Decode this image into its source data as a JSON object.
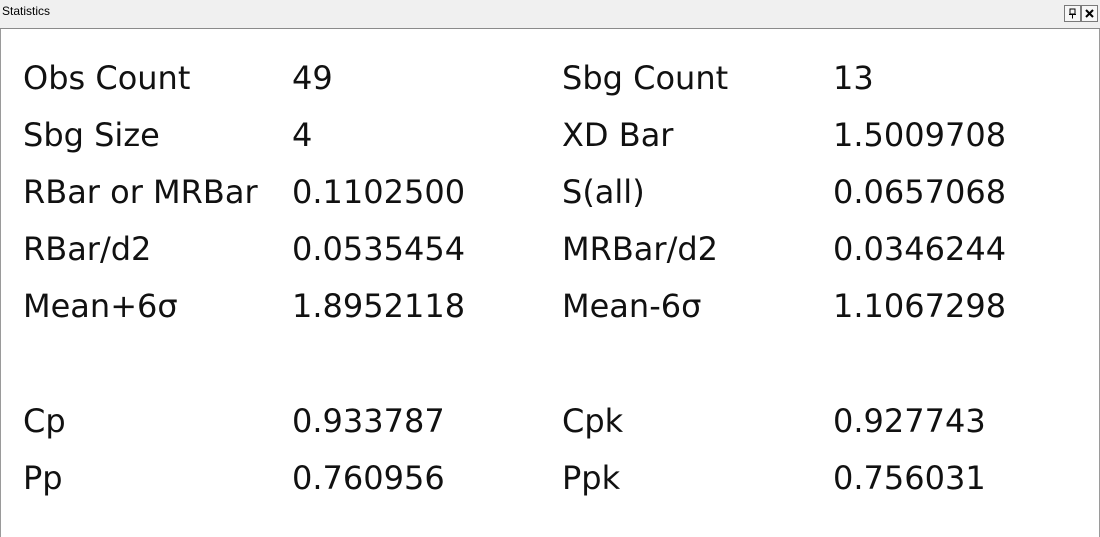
{
  "window": {
    "title": "Statistics",
    "pin_icon": "pin-icon",
    "close_icon": "close-icon"
  },
  "stats": {
    "rows": [
      {
        "label1": "Obs Count",
        "value1": "49",
        "label2": "Sbg Count",
        "value2": "13"
      },
      {
        "label1": "Sbg Size",
        "value1": "4",
        "label2": "XD Bar",
        "value2": "1.5009708"
      },
      {
        "label1": "RBar or MRBar",
        "value1": "0.1102500",
        "label2": "S(all)",
        "value2": "0.0657068"
      },
      {
        "label1": "RBar/d2",
        "value1": "0.0535454",
        "label2": "MRBar/d2",
        "value2": "0.0346244"
      },
      {
        "label1": "Mean+6σ",
        "value1": "1.8952118",
        "label2": "Mean-6σ",
        "value2": "1.1067298"
      }
    ],
    "capability": [
      {
        "label1": "Cp",
        "value1": "0.933787",
        "label2": "Cpk",
        "value2": "0.927743"
      },
      {
        "label1": "Pp",
        "value1": "0.760956",
        "label2": "Ppk",
        "value2": "0.756031"
      }
    ]
  }
}
